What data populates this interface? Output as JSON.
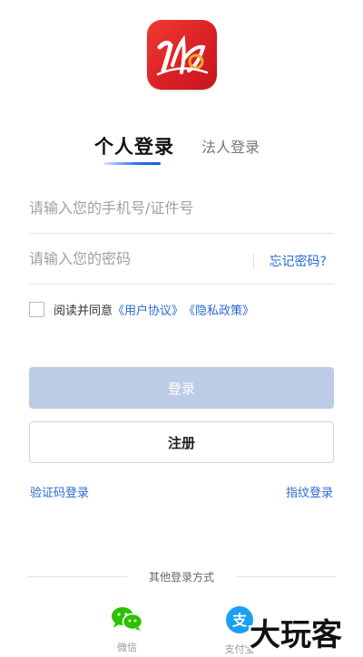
{
  "tabs": {
    "personal": "个人登录",
    "corporate": "法人登录"
  },
  "form": {
    "phone_placeholder": "请输入您的手机号/证件号",
    "password_placeholder": "请输入您的密码",
    "forgot_password": "忘记密码?"
  },
  "agreement": {
    "prefix": "阅读并同意",
    "user_agreement": "《用户协议》",
    "privacy_policy": "《隐私政策》"
  },
  "buttons": {
    "login": "登录",
    "register": "注册"
  },
  "alt_login": {
    "sms": "验证码登录",
    "fingerprint": "指纹登录"
  },
  "other_login": {
    "title": "其他登录方式",
    "wechat": "微信",
    "alipay": "支付宝"
  },
  "watermark": {
    "text": "大玩客"
  },
  "colors": {
    "accent": "#2a69d6",
    "login_button_disabled": "#bccce6",
    "logo_red": "#d81f26",
    "wechat_green": "#2dc100",
    "alipay_blue": "#1a9ff1"
  }
}
